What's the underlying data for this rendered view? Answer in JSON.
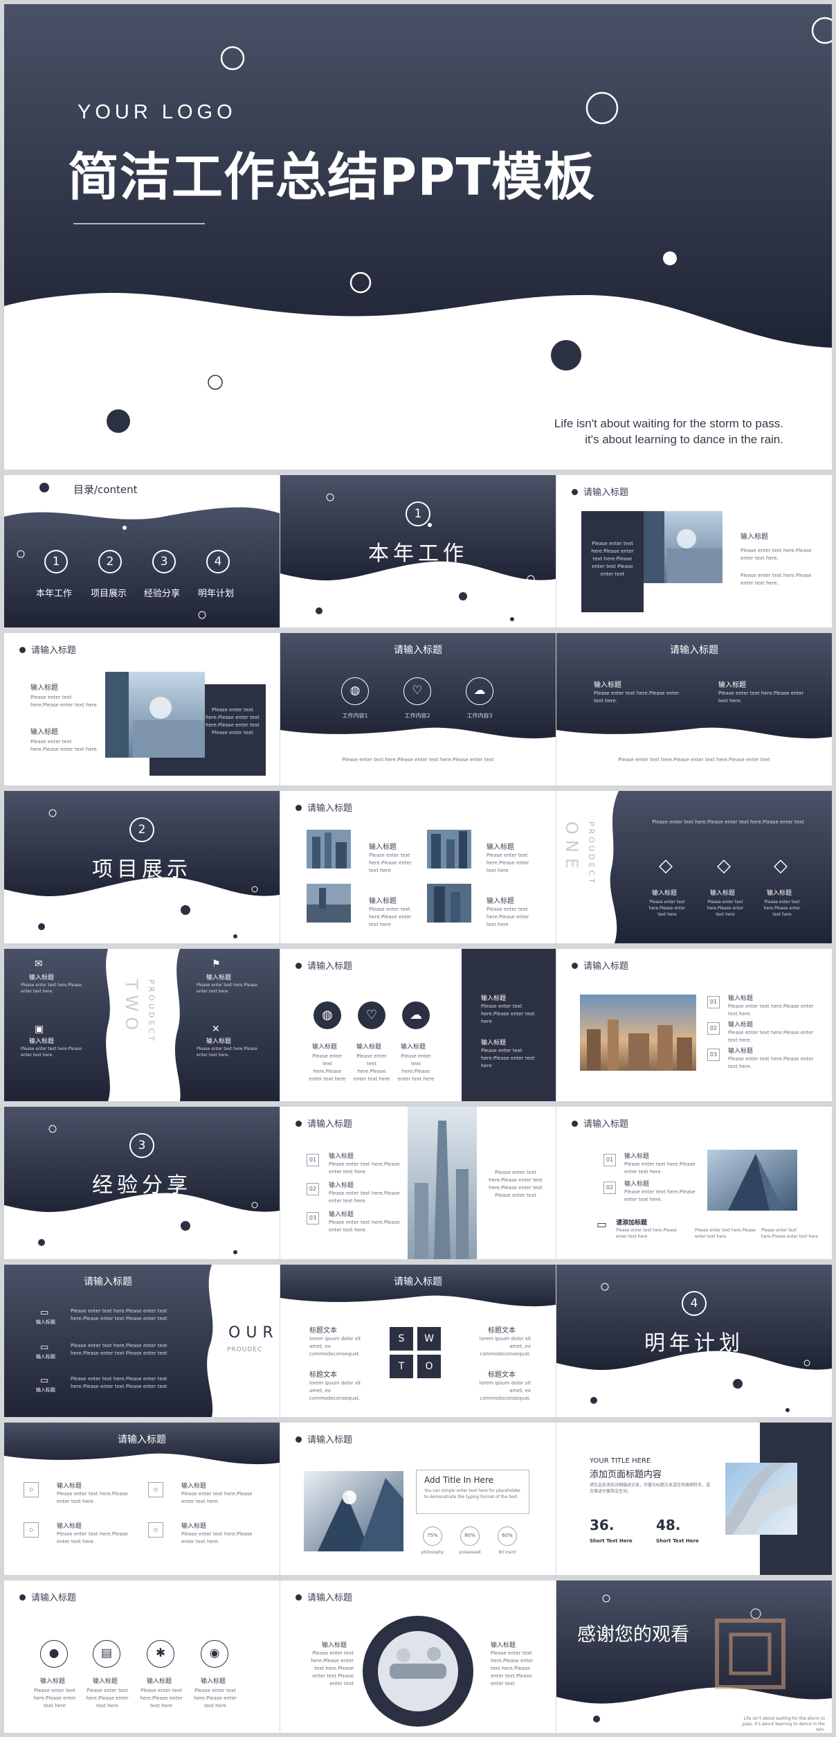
{
  "hero": {
    "logo": "YOUR LOGO",
    "title": "简洁工作总结PPT模板",
    "quote_line1": "Life isn't about waiting for the storm to pass.",
    "quote_line2": "it's about learning to dance in the rain."
  },
  "common": {
    "input_title": "请输入标题",
    "input_heading": "输入标题",
    "enter_text": "Please enter text here.Please enter text here.",
    "enter_short": "Please enter text here.Please enter text here"
  },
  "toc": {
    "label": "目录/content",
    "items": [
      {
        "num": "1",
        "label": "本年工作"
      },
      {
        "num": "2",
        "label": "项目展示"
      },
      {
        "num": "3",
        "label": "经验分享"
      },
      {
        "num": "4",
        "label": "明年计划"
      }
    ]
  },
  "sections": {
    "s1": {
      "num": "1",
      "title": "本年工作"
    },
    "s2": {
      "num": "2",
      "title": "项目展示"
    },
    "s3": {
      "num": "3",
      "title": "经验分享"
    },
    "s4": {
      "num": "4",
      "title": "明年计划"
    }
  },
  "work": {
    "items": [
      "工作内容1",
      "工作内容2",
      "工作内容3"
    ],
    "footer": "Please enter text here.Please enter text here.Please enter text"
  },
  "panel_text": "Please enter text here.Please enter text here.Please enter text Please enter text",
  "prodect_one": {
    "vert": "ONE",
    "small": "PROUDECT"
  },
  "prodect_two": {
    "vert": "TWO",
    "small": "PROUDECT"
  },
  "prodect_our": {
    "big": "OUR",
    "small": "PROUDEC"
  },
  "numbered": [
    "01",
    "02",
    "03"
  ],
  "sub_heading": "请添加标题",
  "swot": {
    "letters": [
      "S",
      "W",
      "T",
      "O"
    ],
    "label": "标题文本",
    "text": "lorem ipsum dolor sit amet, ex commodoconsequat."
  },
  "add_title": {
    "heading": "Add Title In Here",
    "body": "You can simple enter text here for placeholder to demonstrate the typing format of the text.",
    "rings": [
      "75%",
      "80%",
      "60%"
    ],
    "ring_labels": [
      "philosophy",
      "possessed",
      "80 ment"
    ]
  },
  "your_title": {
    "heading": "YOUR TITLE HERE",
    "sub": "添加页面标题内容",
    "body": "请在此处添加详细描述文本，尽量与标题文本语言风格相符合，语言描述尽量简洁生动。",
    "stat1": "36.",
    "stat2": "48.",
    "stat_label": "Short Text Here"
  },
  "thanks": {
    "title": "感谢您的观看",
    "quote": "Life isn't about waiting for the storm to pass. It's about learning to dance in the rain."
  },
  "colors": {
    "navy": "#2b3142",
    "bg": "#d4d6da"
  }
}
